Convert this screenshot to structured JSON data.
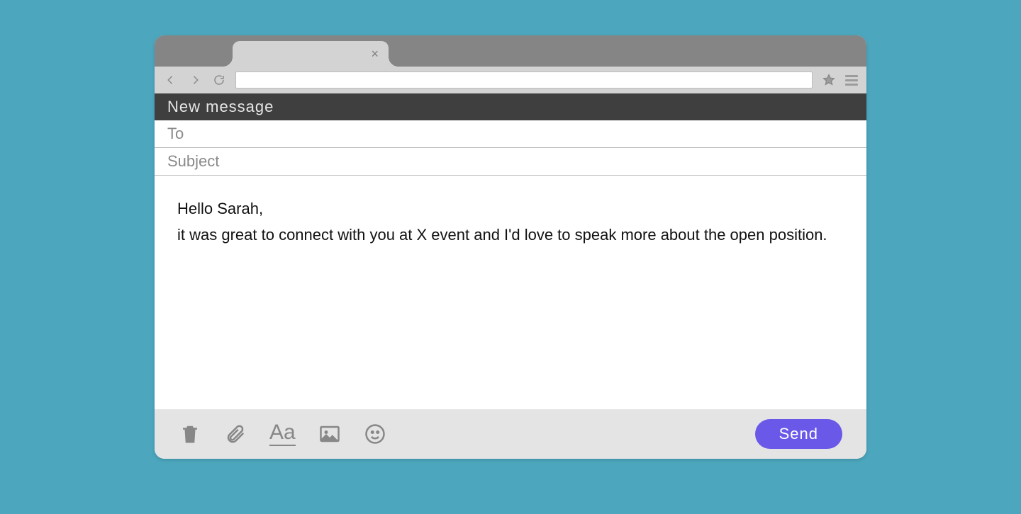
{
  "compose": {
    "header": "New message",
    "to_label": "To",
    "subject_label": "Subject",
    "body": "Hello Sarah,\nit was great to connect with you at X event and I'd love to speak more about the open position.",
    "send_label": "Send"
  }
}
